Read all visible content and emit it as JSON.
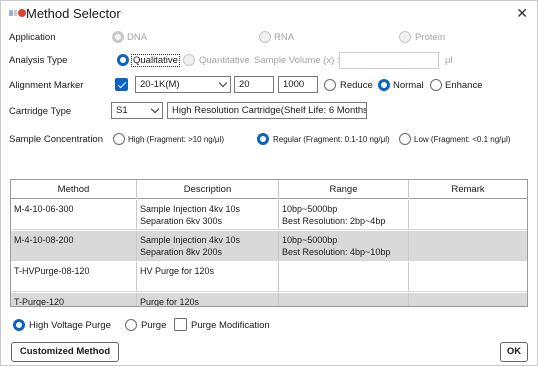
{
  "window": {
    "title": "Method Selector",
    "close_glyph": "✕"
  },
  "application": {
    "label": "Application",
    "options": [
      {
        "label": "DNA",
        "selected": true,
        "enabled": false
      },
      {
        "label": "RNA",
        "selected": false,
        "enabled": false
      },
      {
        "label": "Protein",
        "selected": false,
        "enabled": false
      }
    ]
  },
  "analysis_type": {
    "label": "Analysis Type",
    "qualitative": "Qualitative",
    "quantitative": "Quantitative",
    "sample_volume_label": "Sample Volume (x) :",
    "sample_volume_value": "",
    "unit": "μl"
  },
  "alignment_marker": {
    "label": "Alignment Marker",
    "checked": true,
    "marker_value": "20-1K(M)",
    "low_value": "20",
    "high_value": "1000",
    "reduce": "Reduce",
    "normal": "Normal",
    "enhance": "Enhance",
    "selected": "Normal"
  },
  "cartridge": {
    "label": "Cartridge Type",
    "value": "S1",
    "description": "High Resolution Cartridge(Shelf Life: 6 Months)"
  },
  "concentration": {
    "label": "Sample Concentration",
    "high": "High (Fragment: >10 ng/μl)",
    "regular": "Regular (Fragment: 0.1-10 ng/μl)",
    "low": "Low (Fragment: <0.1 ng/μl)",
    "selected": "Regular"
  },
  "table": {
    "headers": [
      "Method",
      "Description",
      "Range",
      "Remark"
    ],
    "rows": [
      {
        "method": "M-4-10-06-300",
        "desc1": "Sample Injection 4kv 10s",
        "desc2": "Separation 6kv 300s",
        "range1": "10bp~5000bp",
        "range2": "Best Resolution: 2bp~4bp",
        "remark": ""
      },
      {
        "method": "M-4-10-08-200",
        "desc1": "Sample Injection 4kv 10s",
        "desc2": "Separation 8kv 200s",
        "range1": "10bp~5000bp",
        "range2": "Best Resolution: 4bp~10bp",
        "remark": ""
      },
      {
        "method": "T-HVPurge-08-120",
        "desc1": "HV Purge for 120s",
        "desc2": "",
        "range1": "",
        "range2": "",
        "remark": ""
      },
      {
        "method": "T-Purge-120",
        "desc1": "Purge for 120s",
        "desc2": "",
        "range1": "",
        "range2": "",
        "remark": ""
      }
    ]
  },
  "purge": {
    "high_voltage": "High Voltage Purge",
    "purge": "Purge",
    "modification": "Purge Modification",
    "selected": "High Voltage Purge"
  },
  "buttons": {
    "customized": "Customized Method",
    "ok": "OK"
  },
  "colors": {
    "accent": "#0a64c4",
    "row_alt": "#d9d9d9"
  }
}
